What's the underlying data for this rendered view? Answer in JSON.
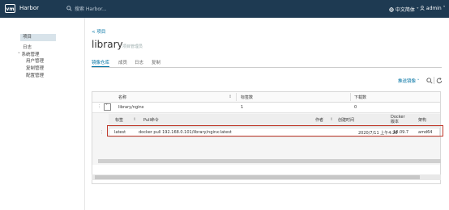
{
  "app": {
    "logo": "vm",
    "brand": "Harbor"
  },
  "search": {
    "placeholder": "搜索 Harbor..."
  },
  "header": {
    "language": "中文简体",
    "user": "admin"
  },
  "sidebar": {
    "items": [
      {
        "label": "项目",
        "active": true
      },
      {
        "label": "日志"
      },
      {
        "label": "系统管理",
        "expandable": true
      },
      {
        "label": "用户管理"
      },
      {
        "label": "复制管理"
      },
      {
        "label": "配置管理"
      }
    ]
  },
  "breadcrumb": {
    "back": "< 项目"
  },
  "project": {
    "name": "library",
    "role": "项目管理员"
  },
  "tabs": [
    {
      "label": "镜像仓库",
      "active": true
    },
    {
      "label": "成员"
    },
    {
      "label": "日志"
    },
    {
      "label": "复制"
    }
  ],
  "toolbar": {
    "push_image": "推送镜像"
  },
  "table": {
    "headers": [
      "名称",
      "标签数",
      "下载数"
    ],
    "rows": [
      {
        "name": "library/nginx",
        "tags": "1",
        "pulls": "0"
      }
    ]
  },
  "tag_table": {
    "headers": [
      "标签",
      "Pull命令",
      "作者",
      "创建时间",
      "Docker版本",
      "架构"
    ],
    "rows": [
      {
        "tag": "latest",
        "pull": "docker pull 192.168.0.101/library/nginx:latest",
        "author": "",
        "created": "2020/7/11 上午4:26",
        "docker": "18.09.7",
        "arch": "amd64"
      }
    ]
  },
  "colors": {
    "header_bg": "#1e3a52",
    "accent": "#0072a3",
    "highlight": "#c0392b"
  }
}
